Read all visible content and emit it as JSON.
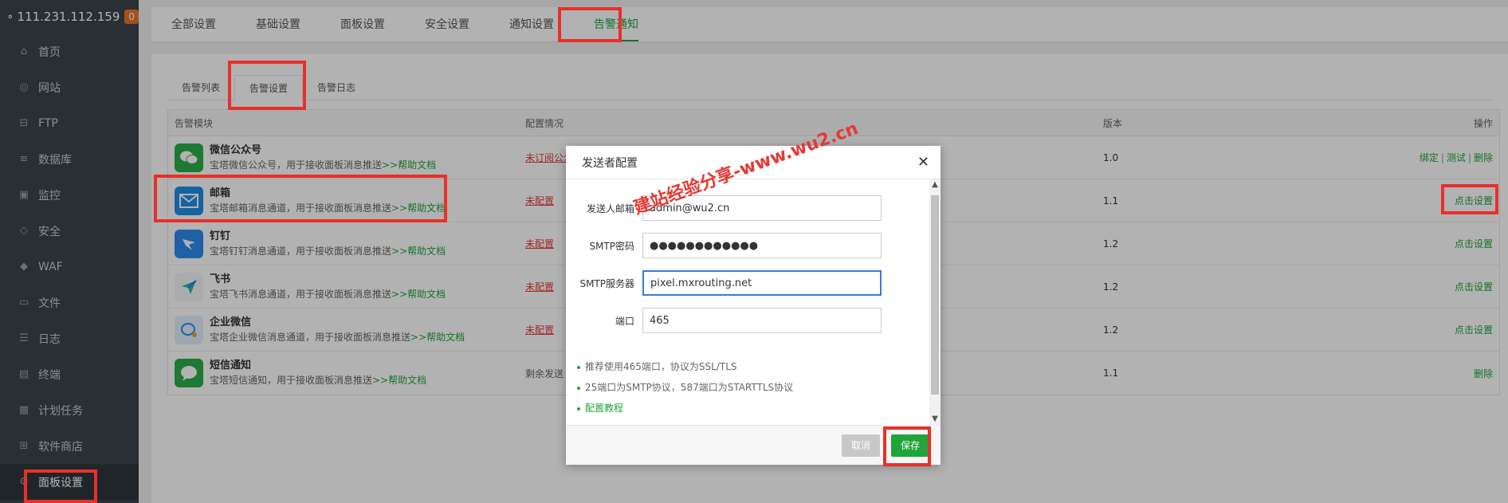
{
  "server": {
    "ip": "111.231.112.159",
    "badge": "0"
  },
  "sidebar": {
    "items": [
      {
        "label": "首页",
        "icon": "home-icon"
      },
      {
        "label": "网站",
        "icon": "globe-icon"
      },
      {
        "label": "FTP",
        "icon": "ftp-icon"
      },
      {
        "label": "数据库",
        "icon": "database-icon"
      },
      {
        "label": "监控",
        "icon": "monitor-icon"
      },
      {
        "label": "安全",
        "icon": "shield-icon"
      },
      {
        "label": "WAF",
        "icon": "waf-icon"
      },
      {
        "label": "文件",
        "icon": "folder-icon"
      },
      {
        "label": "日志",
        "icon": "log-icon"
      },
      {
        "label": "终端",
        "icon": "terminal-icon"
      },
      {
        "label": "计划任务",
        "icon": "calendar-icon"
      },
      {
        "label": "软件商店",
        "icon": "apps-icon"
      },
      {
        "label": "面板设置",
        "icon": "settings-icon"
      }
    ]
  },
  "top_tabs": [
    "全部设置",
    "基础设置",
    "面板设置",
    "安全设置",
    "通知设置",
    "告警通知"
  ],
  "sub_tabs": [
    "告警列表",
    "告警设置",
    "告警日志"
  ],
  "table": {
    "headers": [
      "告警模块",
      "配置情况",
      "版本",
      "操作"
    ],
    "rows": [
      {
        "title": "微信公众号",
        "desc": "宝塔微信公众号，用于接收面板消息推送",
        "help": ">>帮助文档",
        "status": "未订阅公众号",
        "version": "1.0",
        "actions": [
          "绑定",
          "测试",
          "删除"
        ],
        "color": "#2bae4a"
      },
      {
        "title": "邮箱",
        "desc": "宝塔邮箱消息通道，用于接收面板消息推送",
        "help": ">>帮助文档",
        "status": "未配置",
        "version": "1.1",
        "actions": [
          "点击设置"
        ],
        "color": "#1f8ee6"
      },
      {
        "title": "钉钉",
        "desc": "宝塔钉钉消息通道，用于接收面板消息推送",
        "help": ">>帮助文档",
        "status": "未配置",
        "version": "1.2",
        "actions": [
          "点击设置"
        ],
        "color": "#2d8cf0"
      },
      {
        "title": "飞书",
        "desc": "宝塔飞书消息通道，用于接收面板消息推送",
        "help": ">>帮助文档",
        "status": "未配置",
        "version": "1.2",
        "actions": [
          "点击设置"
        ],
        "color": "#f3f5f7"
      },
      {
        "title": "企业微信",
        "desc": "宝塔企业微信消息通道，用于接收面板消息推送",
        "help": ">>帮助文档",
        "status": "未配置",
        "version": "1.2",
        "actions": [
          "点击设置"
        ],
        "color": "#e3eefb"
      },
      {
        "title": "短信通知",
        "desc": "宝塔短信通知，用于接收面板消息推送",
        "help": ">>帮助文档",
        "status": "剩余发送",
        "version": "1.1",
        "actions": [
          "删除"
        ],
        "color": "#2bae4a"
      }
    ]
  },
  "dialog": {
    "title": "发送者配置",
    "fields": [
      {
        "label": "发送人邮箱",
        "value": "admin@wu2.cn"
      },
      {
        "label": "SMTP密码",
        "value": "●●●●●●●●●●●●"
      },
      {
        "label": "SMTP服务器",
        "value": "pixel.mxrouting.net"
      },
      {
        "label": "端口",
        "value": "465"
      }
    ],
    "tips": [
      "推荐使用465端口，协议为SSL/TLS",
      "25端口为SMTP协议，587端口为STARTTLS协议",
      "配置教程"
    ],
    "cancel": "取消",
    "save": "保存"
  },
  "watermark": "建站经验分享-www.wu2.cn"
}
